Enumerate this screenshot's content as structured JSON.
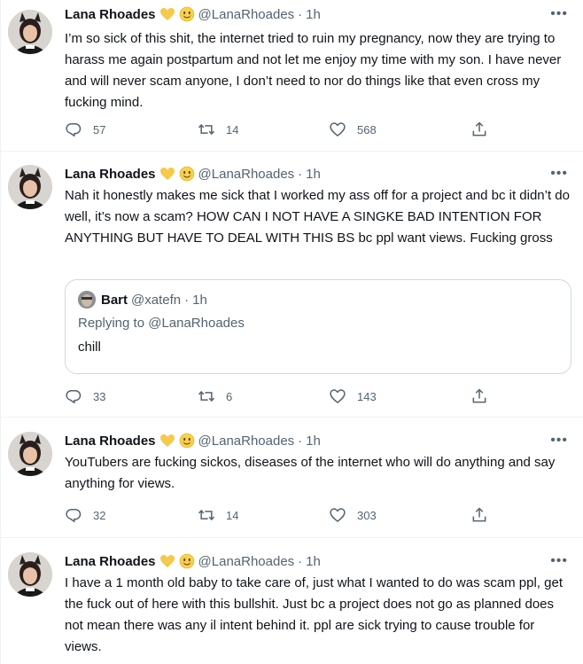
{
  "tweets": [
    {
      "name": "Lana Rhoades",
      "handle": "@LanaRhoades",
      "dot": "·",
      "time": "1h",
      "more": "•••",
      "text": "I’m so sick of this shit, the internet tried to ruin my pregnancy, now they are trying to harass me again postpartum and not let me enjoy my time with my son. I have never and will never scam anyone, I don’t need to nor do things like that even cross my fucking mind.",
      "replies": "57",
      "retweets": "14",
      "likes": "568"
    },
    {
      "name": "Lana Rhoades",
      "handle": "@LanaRhoades",
      "dot": "·",
      "time": "1h",
      "more": "•••",
      "text": "Nah it honestly makes me sick that I worked my ass off for a project and bc it didn’t do well, it’s now a scam? HOW CAN I NOT HAVE A SINGKE BAD INTENTION FOR ANYTHING BUT HAVE TO DEAL WITH THIS BS bc ppl want views. Fucking gross",
      "quote": {
        "name": "Bart",
        "handle": "@xatefn",
        "dot": "·",
        "time": "1h",
        "replying_to": "Replying to @LanaRhoades",
        "text": "chill"
      },
      "replies": "33",
      "retweets": "6",
      "likes": "143"
    },
    {
      "name": "Lana Rhoades",
      "handle": "@LanaRhoades",
      "dot": "·",
      "time": "1h",
      "more": "•••",
      "text": "YouTubers are fucking sickos, diseases of the internet who will do anything and say anything for views.",
      "replies": "32",
      "retweets": "14",
      "likes": "303"
    },
    {
      "name": "Lana Rhoades",
      "handle": "@LanaRhoades",
      "dot": "·",
      "time": "1h",
      "more": "•••",
      "text": "I have a 1 month old baby to take care of, just what I wanted to do was scam ppl, get the fuck out of here with this bullshit. Just bc a project does not go as planned does not mean there was any il intent behind it. ppl are sick trying to cause trouble for views."
    }
  ],
  "colors": {
    "text_primary": "#0f1419",
    "text_secondary": "#536471",
    "border": "#eff3f4",
    "quote_border": "#cfd9de",
    "heart_emoji": "#f5c94c",
    "face_emoji": "#f7d24b"
  },
  "icons": {
    "reply": "reply-icon",
    "retweet": "retweet-icon",
    "like": "heart-outline-icon",
    "share": "share-icon",
    "more": "more-options-icon",
    "yellow_heart": "yellow-heart-emoji",
    "smiling_face": "smiling-face-emoji"
  }
}
